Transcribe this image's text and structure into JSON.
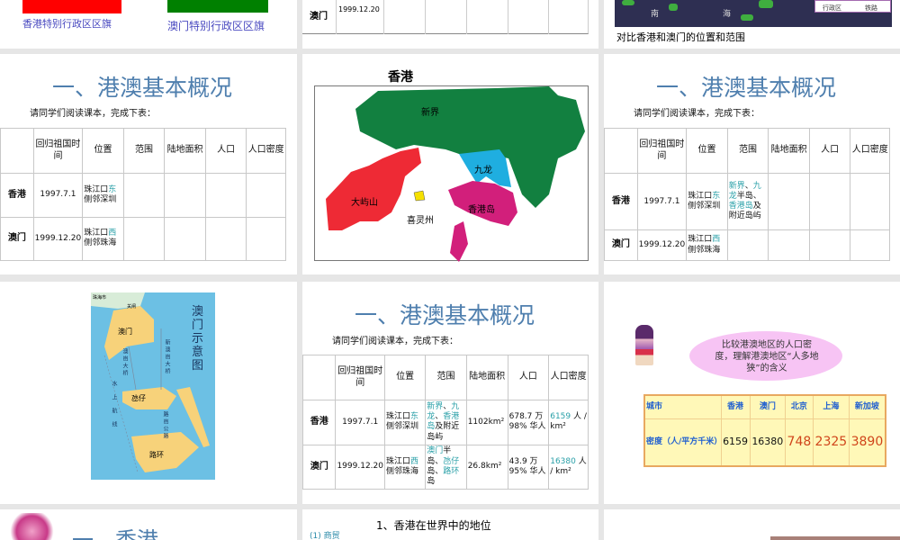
{
  "colors": {
    "accent_title": "#4f7fae",
    "highlight": "#2aa0a8",
    "hk_flag": "#ff0000",
    "mo_flag": "#008000",
    "density_table_bg": "#fff8b8"
  },
  "slides": {
    "s1": {
      "hk_flag_caption": "香港特别行政区区旗",
      "mo_flag_caption": "澳门特别行政区区旗"
    },
    "s2": {
      "row_label": "澳门",
      "row_date": "1999.12.20"
    },
    "s3": {
      "map_labels": [
        "南",
        "海"
      ],
      "legend": [
        "行政区",
        "铁路"
      ],
      "caption": "对比香港和澳门的位置和范围"
    },
    "s4": {
      "title": "一、港澳基本概况",
      "subtitle": "请同学们阅读课本，完成下表："
    },
    "s5": {
      "title": "香港",
      "regions": [
        "新界",
        "九龙",
        "大屿山",
        "香港岛",
        "喜灵州"
      ]
    },
    "s6": {
      "title": "一、港澳基本概况",
      "subtitle": "请同学们阅读课本，完成下表："
    },
    "s7": {
      "title": "澳门示意图",
      "labels": [
        "珠海市",
        "关闸",
        "澳门",
        "氹仔",
        "路环",
        "新澳凼大桥",
        "澳凼大桥",
        "路凼公路",
        "水上航线"
      ]
    },
    "s8": {
      "title": "一、港澳基本概况",
      "subtitle": "请同学们阅读课本，完成下表："
    },
    "s9": {
      "bubble": "比较港澳地区的人口密度，理解港澳地区“人多地狭”的含义",
      "headers": [
        "城市",
        "香港",
        "澳门",
        "北京",
        "上海",
        "新加坡"
      ],
      "row_label": "密度（人/平方千米）",
      "values": [
        "6159",
        "16380",
        "748",
        "2325",
        "3890"
      ]
    },
    "s10": {
      "title": "一、香港"
    },
    "s11": {
      "title": "1、香港在世界中的地位",
      "bullet": "(1) 商贸"
    }
  },
  "tables": {
    "headers": [
      "",
      "回归祖国时间",
      "位置",
      "范围",
      "陆地面积",
      "人口",
      "人口密度"
    ],
    "t4": [
      [
        [
          {
            "t": "香港"
          }
        ],
        [
          {
            "t": "1997.7.1"
          }
        ],
        [
          {
            "t": "珠江口"
          },
          {
            "t": "东",
            "hl": true
          },
          {
            "t": "侧邻深圳"
          }
        ],
        [],
        [],
        [],
        []
      ],
      [
        [
          {
            "t": "澳门"
          }
        ],
        [
          {
            "t": "1999.12.20"
          }
        ],
        [
          {
            "t": "珠江口"
          },
          {
            "t": "西",
            "hl": true
          },
          {
            "t": "侧邻珠海"
          }
        ],
        [],
        [],
        [],
        []
      ]
    ],
    "t6": [
      [
        [
          {
            "t": "香港"
          }
        ],
        [
          {
            "t": "1997.7.1"
          }
        ],
        [
          {
            "t": "珠江口"
          },
          {
            "t": "东",
            "hl": true
          },
          {
            "t": "侧邻深圳"
          }
        ],
        [
          {
            "t": "新界",
            "hl": true
          },
          {
            "t": "、"
          },
          {
            "t": "九龙",
            "hl": true
          },
          {
            "t": "半岛、"
          },
          {
            "t": "香港岛",
            "hl": true
          },
          {
            "t": "及附近岛屿"
          }
        ],
        [],
        [],
        []
      ],
      [
        [
          {
            "t": "澳门"
          }
        ],
        [
          {
            "t": "1999.12.20"
          }
        ],
        [
          {
            "t": "珠江口"
          },
          {
            "t": "西",
            "hl": true
          },
          {
            "t": "侧邻珠海"
          }
        ],
        [],
        [],
        [],
        []
      ]
    ],
    "t8": [
      [
        [
          {
            "t": "香港"
          }
        ],
        [
          {
            "t": "1997.7.1"
          }
        ],
        [
          {
            "t": "珠江口"
          },
          {
            "t": "东",
            "hl": true
          },
          {
            "t": "侧邻深圳"
          }
        ],
        [
          {
            "t": "新界",
            "hl": true
          },
          {
            "t": "、"
          },
          {
            "t": "九龙",
            "hl": true
          },
          {
            "t": "、"
          },
          {
            "t": "香港岛",
            "hl": true
          },
          {
            "t": "及附近岛屿"
          }
        ],
        [
          {
            "t": "1102km²"
          }
        ],
        [
          {
            "t": "678.7 万 98% 华人"
          }
        ],
        [
          {
            "t": "6159",
            "hl": true
          },
          {
            "t": " 人 / km²"
          }
        ]
      ],
      [
        [
          {
            "t": "澳门"
          }
        ],
        [
          {
            "t": "1999.12.20"
          }
        ],
        [
          {
            "t": "珠江口"
          },
          {
            "t": "西",
            "hl": true
          },
          {
            "t": "侧邻珠海"
          }
        ],
        [
          {
            "t": "澳门",
            "hl": true
          },
          {
            "t": "半岛、"
          },
          {
            "t": "氹仔",
            "hl": true
          },
          {
            "t": "岛、"
          },
          {
            "t": "路环",
            "hl": true
          },
          {
            "t": "岛"
          }
        ],
        [
          {
            "t": "26.8km²"
          }
        ],
        [
          {
            "t": "43.9 万 95% 华人"
          }
        ],
        [
          {
            "t": "16380",
            "hl": true
          },
          {
            "t": " 人 / km²"
          }
        ]
      ]
    ]
  }
}
